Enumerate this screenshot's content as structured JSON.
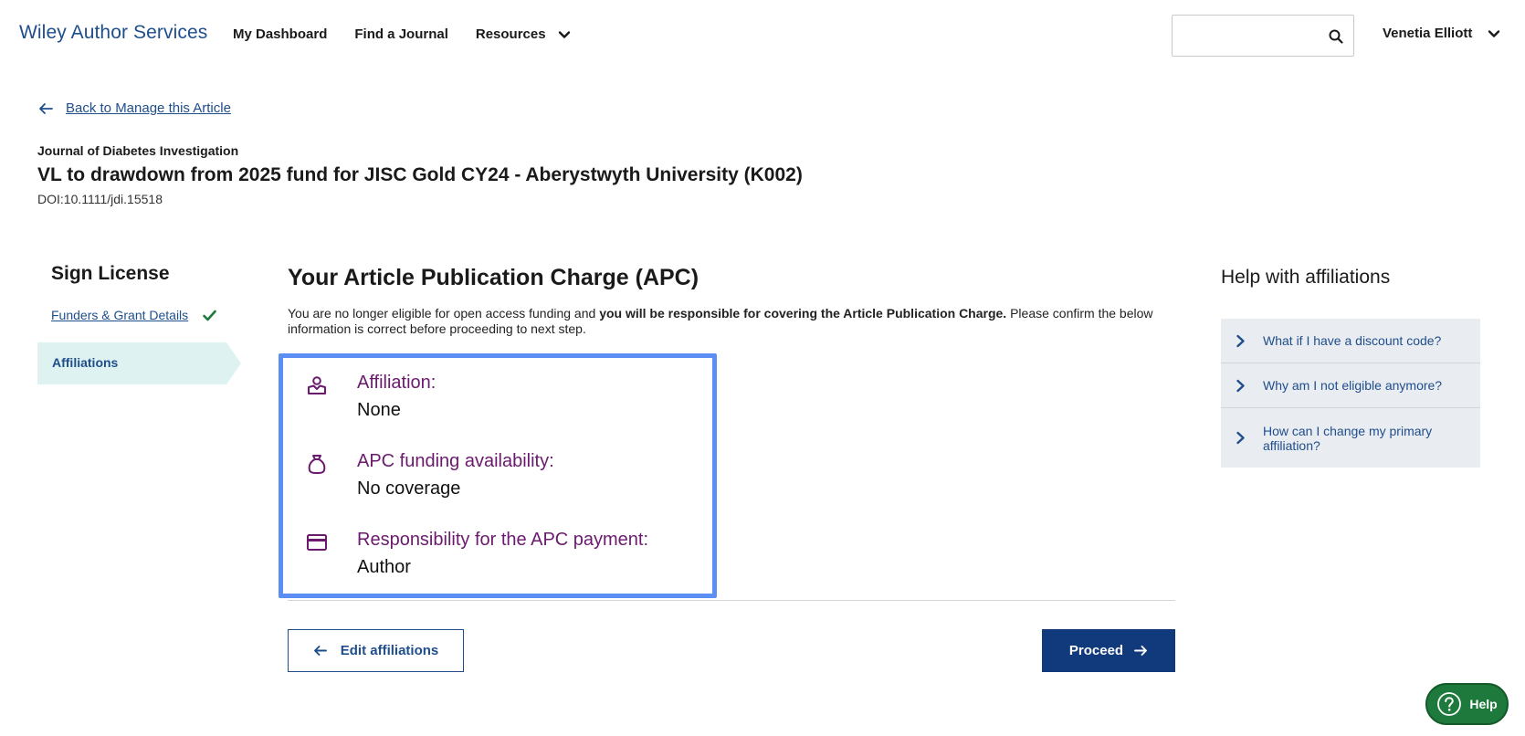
{
  "header": {
    "brand": "Wiley Author Services",
    "nav": [
      {
        "label": "My Dashboard"
      },
      {
        "label": "Find a Journal"
      },
      {
        "label": "Resources"
      }
    ],
    "search_placeholder": "",
    "user_name": "Venetia Elliott"
  },
  "article": {
    "back_label": "Back to Manage this Article",
    "journal": "Journal of Diabetes Investigation",
    "title": "VL to drawdown from 2025 fund for JISC Gold CY24 - Aberystwyth University (K002)",
    "doi": "DOI:10.1111/jdi.15518"
  },
  "stepper": {
    "title": "Sign License",
    "steps": [
      {
        "label": "Funders & Grant Details",
        "status": "complete"
      },
      {
        "label": "Affiliations",
        "status": "current"
      }
    ]
  },
  "main": {
    "title": "Your Article Publication Charge (APC)",
    "intro_pre": "You are no longer eligible for open access funding and ",
    "intro_bold": "you will be responsible for covering the Article Publication Charge.",
    "intro_post": " Please confirm the below information is correct before proceeding to next step.",
    "info": [
      {
        "label": "Affiliation:",
        "value": "None",
        "icon": "affiliation-icon"
      },
      {
        "label": "APC funding availability:",
        "value": "No coverage",
        "icon": "money-bag-icon"
      },
      {
        "label": "Responsibility for the APC payment:",
        "value": "Author",
        "icon": "credit-card-icon"
      }
    ],
    "edit_label": "Edit affiliations",
    "proceed_label": "Proceed"
  },
  "help": {
    "title": "Help with affiliations",
    "faqs": [
      "What if I have a discount code?",
      "Why am I not eligible anymore?",
      "How can I change my primary affiliation?"
    ],
    "fab_label": "Help"
  },
  "colors": {
    "brand_blue": "#1f4e8c",
    "primary_button": "#113a7c",
    "accent_purple": "#6b1a6e",
    "highlight_border": "#5b8ff3",
    "check_green": "#1e7a3c",
    "step_current_bg": "#dff2f2"
  }
}
